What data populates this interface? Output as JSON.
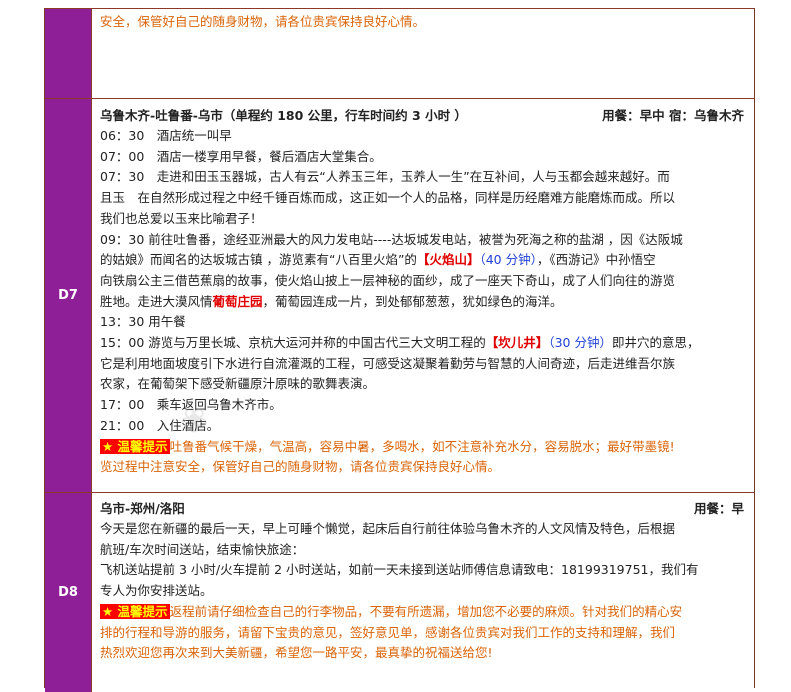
{
  "row_top": {
    "text": "安全，保管好自己的随身财物，请各位贵宾保持良好心情。"
  },
  "d7": {
    "day": "D7",
    "title": "乌鲁木齐-吐鲁番-乌市（单程约 180 公里，行车时间约 3 小时 ）",
    "meal": "用餐：早中 宿：乌鲁木齐",
    "l1": "06：30　酒店统一叫早",
    "l2": "07：00　酒店一楼享用早餐，餐后酒店大堂集合。",
    "l3": "07：30　走进和田玉玉器城，古人有云“人养玉三年，玉养人一生”在互补间，人与玉都会越来越好。而",
    "l4": "且玉　在自然形成过程之中经千锤百炼而成，这正如一个人的品格，同样是历经磨难方能磨炼而成。所以",
    "l5": "我们也总爱以玉来比喻君子！",
    "l6": "09：30 前往吐鲁番，途经亚洲最大的风力发电站----达坂城发电站，被誉为死海之称的盐湖 ，因《达阪城",
    "l7a": "的姑娘》而闻名的达坂城古镇 ，游览素有“八百里火焰”的",
    "l7b": "【火焰山】",
    "l7c": "（40 分钟）",
    "l7d": "，《西游记》中孙悟空",
    "l8": "向铁扇公主三借芭蕉扇的故事，使火焰山披上一层神秘的面纱，成了一座天下奇山，成了人们向往的游览",
    "l9a": "胜地。走进大漠风情",
    "l9b": "葡萄庄园",
    "l9c": "，葡萄园连成一片，到处郁郁葱葱，犹如绿色的海洋。",
    "l10": "13：30 用午餐",
    "l11a": "15：00 游览与万里长城、京杭大运河并称的中国古代三大文明工程的",
    "l11b": "【坎儿井】",
    "l11c": "（30 分钟）",
    "l11d": "即井穴的意思，",
    "l12": "它是利用地面坡度引下水进行自流灌溉的工程，可感受这凝聚着勤劳与智慧的人间奇迹，后走进维吾尔族",
    "l13": "农家，在葡萄架下感受新疆原汁原味的歌舞表演。",
    "l14": "17：00　乘车返回乌鲁木齐市。",
    "l15": "21：00　入住酒店。",
    "tip_label": "★ 温馨提示",
    "tip_text": "吐鲁番气候干燥，气温高，容易中暑，多喝水，如不注意补充水分，容易脱水；最好带墨镜!",
    "tip_text2": "览过程中注意安全，保管好自己的随身财物，请各位贵宾保持良好心情。"
  },
  "d8": {
    "day": "D8",
    "title": "乌市-郑州/洛阳",
    "meal": "用餐：早",
    "l1": "今天是您在新疆的最后一天，早上可睡个懒觉，起床后自行前往体验乌鲁木齐的人文风情及特色，后根据",
    "l2": "航班/车次时间送站，结束愉快旅途：",
    "l3": "飞机送站提前 3 小时/火车提前 2 小时送站，如前一天未接到送站师傅信息请致电：18199319751，我们有",
    "l4": "专人为你安排送站。",
    "tip_label": "★ 温馨提示",
    "tip_text": "返程前请仔细检查自己的行李物品，不要有所遗漏，增加您不必要的麻烦。针对我们的精心安",
    "tip_text2": "排的行程和导游的服务，请留下宝贵的意见，签好意见单，感谢各位贵宾对我们工作的支持和理解，我们",
    "tip_text3": "热烈欢迎您再次来到大美新疆，希望您一路平安，最真挚的祝福送给您!"
  }
}
